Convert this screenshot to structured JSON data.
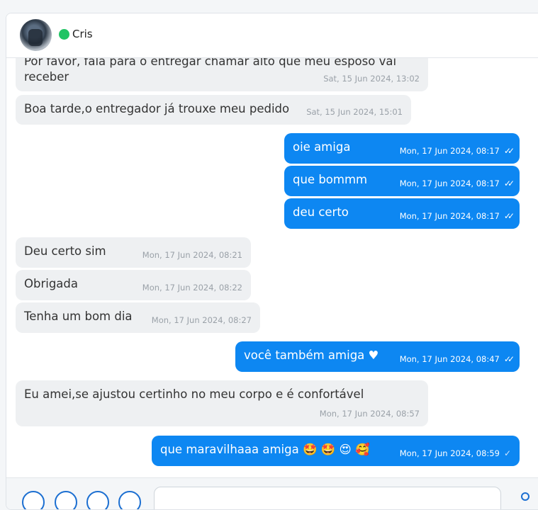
{
  "contact": {
    "name": "Cris",
    "status_color": "#20c464"
  },
  "messages": [
    {
      "direction": "in",
      "text": "Por favor, fala para o entregar chamar alto que meu esposo vai receber",
      "time": "Sat, 15 Jun 2024, 13:02"
    },
    {
      "direction": "in",
      "text": "Boa tarde,o entregador já trouxe meu pedido",
      "time": "Sat, 15 Jun 2024, 15:01"
    },
    {
      "direction": "out",
      "text": "oie amiga",
      "time": "Mon, 17 Jun 2024, 08:17",
      "read": true
    },
    {
      "direction": "out",
      "text": "que bommm",
      "time": "Mon, 17 Jun 2024, 08:17",
      "read": true
    },
    {
      "direction": "out",
      "text": "deu certo",
      "time": "Mon, 17 Jun 2024, 08:17",
      "read": true
    },
    {
      "direction": "in",
      "text": "Deu certo sim",
      "time": "Mon, 17 Jun 2024, 08:21"
    },
    {
      "direction": "in",
      "text": "Obrigada",
      "time": "Mon, 17 Jun 2024, 08:22"
    },
    {
      "direction": "in",
      "text": "Tenha um bom dia",
      "time": "Mon, 17 Jun 2024, 08:27"
    },
    {
      "direction": "out",
      "text": "você também amiga ♥",
      "time": "Mon, 17 Jun 2024, 08:47",
      "read": true
    },
    {
      "direction": "in",
      "text": "Eu amei,se ajustou certinho no meu corpo e é confortável",
      "time": "Mon, 17 Jun 2024, 08:57"
    },
    {
      "direction": "out",
      "text": "que maravilhaaa amiga 🤩 🤩 😍 🥰",
      "time": "Mon, 17 Jun 2024, 08:59",
      "read": false
    }
  ],
  "icons": {
    "read_receipt": "double-check-icon",
    "delivered_receipt": "single-check-icon",
    "send": "send-icon"
  },
  "composer": {
    "placeholder": ""
  },
  "colors": {
    "outgoing": "#0d87f2",
    "incoming": "#eef0f2"
  }
}
